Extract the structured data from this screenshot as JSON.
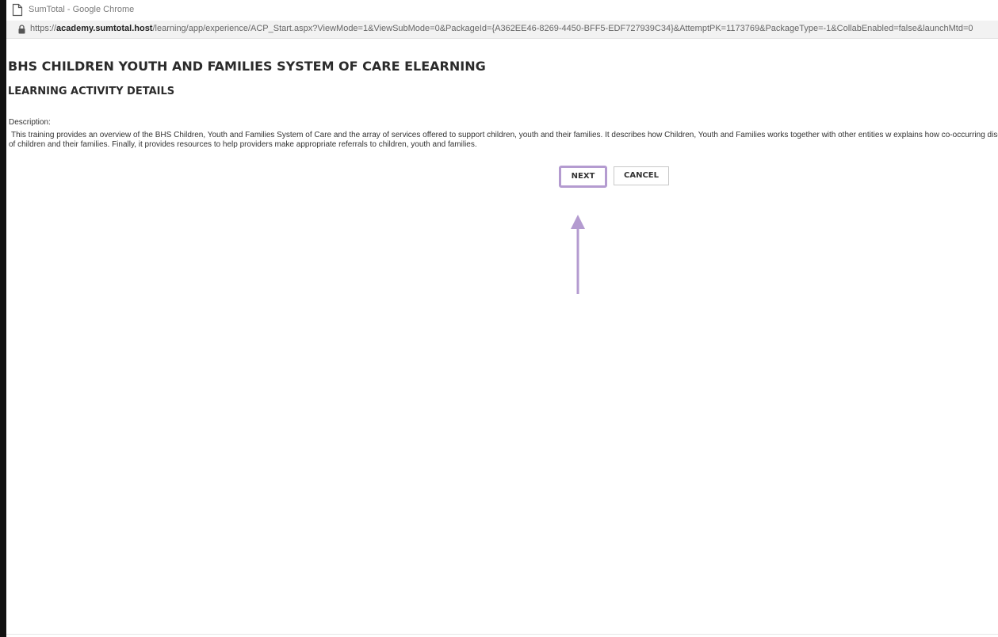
{
  "window": {
    "title": "SumTotal - Google Chrome"
  },
  "address_bar": {
    "url_scheme": "https://",
    "url_host": "academy.sumtotal.host",
    "url_path": "/learning/app/experience/ACP_Start.aspx?ViewMode=1&ViewSubMode=0&PackageId={A362EE46-8269-4450-BFF5-EDF727939C34}&AttemptPK=1173769&PackageType=-1&CollabEnabled=false&launchMtd=0"
  },
  "page": {
    "title": "BHS CHILDREN YOUTH AND FAMILIES SYSTEM OF CARE ELEARNING",
    "section_heading": "LEARNING ACTIVITY DETAILS",
    "description_label": "Description:",
    "description_text": "This training provides an overview of the BHS Children, Youth and Families System of Care and the array of services offered to support children, youth and their families. It describes how Children, Youth and Families works together with other entities w explains how co-occurring disorders impact the lives of children and their families. Finally, it provides resources to help providers make appropriate referrals to children, youth and families."
  },
  "buttons": {
    "next_label": "NEXT",
    "cancel_label": "CANCEL"
  },
  "annotation": {
    "highlight_color": "#b49bd0"
  },
  "icons": {
    "page": "page-icon",
    "lock": "lock-icon",
    "arrow": "arrow-up-icon"
  }
}
